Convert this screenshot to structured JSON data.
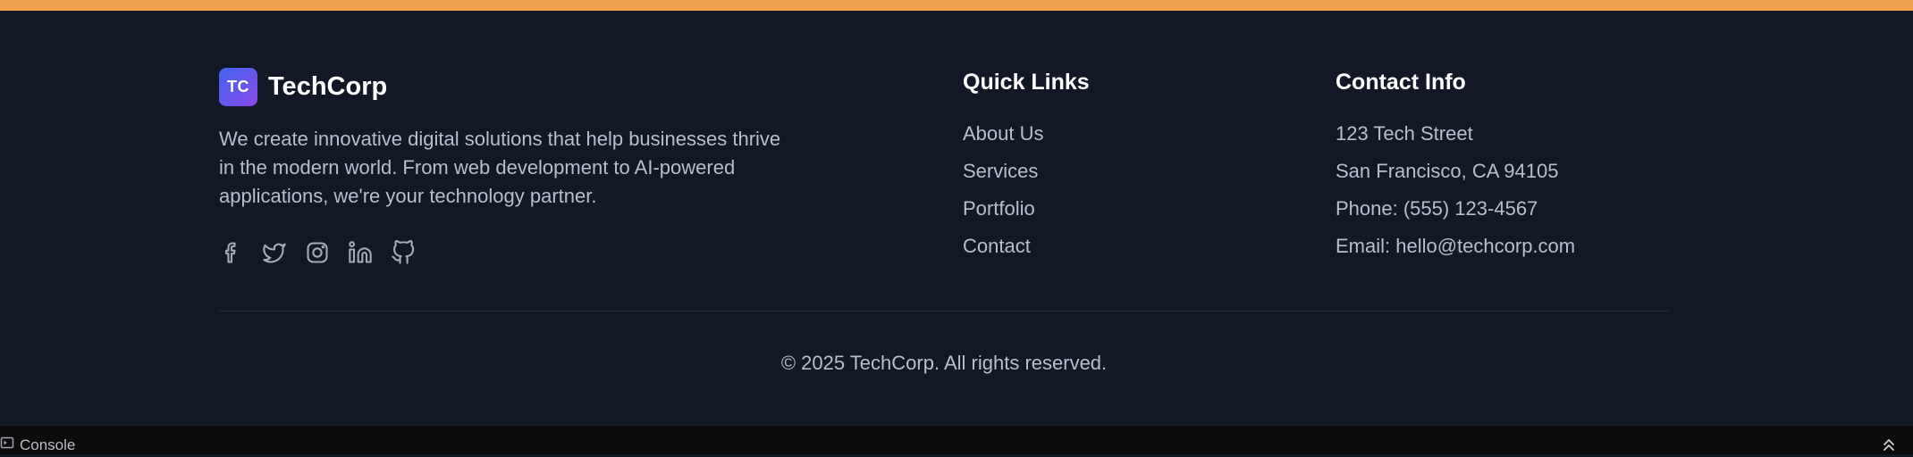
{
  "brand": {
    "logo_text": "TC",
    "name": "TechCorp"
  },
  "description": "We create innovative digital solutions that help businesses thrive in the modern world. From web development to AI-powered applications, we're your technology partner.",
  "socials": [
    "facebook-icon",
    "twitter-icon",
    "instagram-icon",
    "linkedin-icon",
    "github-icon"
  ],
  "quick_links": {
    "title": "Quick Links",
    "items": [
      "About Us",
      "Services",
      "Portfolio",
      "Contact"
    ]
  },
  "contact": {
    "title": "Contact Info",
    "address": "123 Tech Street",
    "city": "San Francisco, CA 94105",
    "phone": "Phone: (555) 123-4567",
    "email": "Email: hello@techcorp.com"
  },
  "copyright": "© 2025 TechCorp. All rights reserved.",
  "console": {
    "label": "Console"
  },
  "colors": {
    "accent": "#f0a34f",
    "background": "#131826",
    "logo_gradient_start": "#3f65f0",
    "logo_gradient_end": "#8a48ea"
  }
}
